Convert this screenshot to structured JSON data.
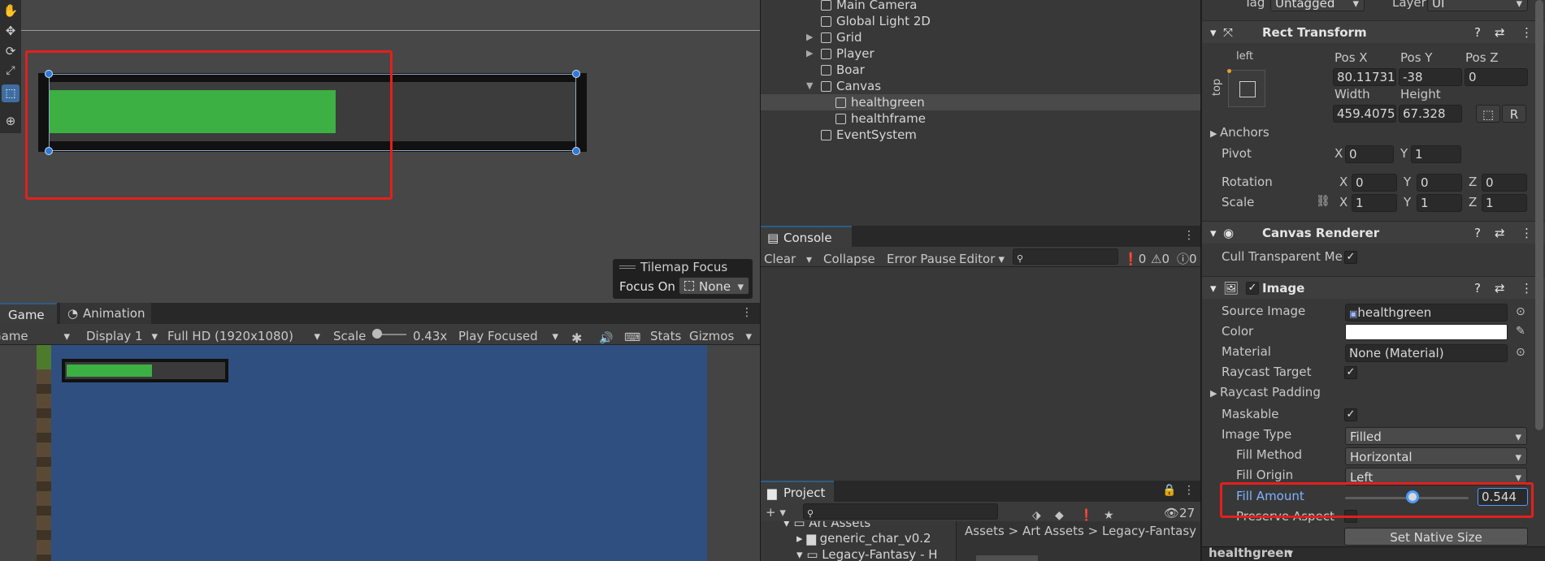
{
  "scene": {
    "tools": [
      "hand-tool",
      "move-tool",
      "rotate-tool",
      "scale-tool",
      "rect-tool",
      "transform-tool"
    ],
    "tilemap_focus": {
      "title": "Tilemap Focus",
      "focus_label": "Focus On",
      "focus_value": "None"
    }
  },
  "game": {
    "tabs": [
      {
        "label": "Game"
      },
      {
        "label": "Animation"
      }
    ],
    "toolbar": {
      "view_select": "Game",
      "display": "Display 1",
      "resolution": "Full HD (1920x1080)",
      "scale_label": "Scale",
      "scale_value": "0.43x",
      "play_mode": "Play Focused",
      "stats": "Stats",
      "gizmos": "Gizmos"
    },
    "health_fill": 0.544
  },
  "hierarchy": {
    "items": [
      {
        "label": "Main Camera",
        "indent": 1,
        "arrow": ""
      },
      {
        "label": "Global Light 2D",
        "indent": 1,
        "arrow": ""
      },
      {
        "label": "Grid",
        "indent": 1,
        "arrow": "▶"
      },
      {
        "label": "Player",
        "indent": 1,
        "arrow": "▶"
      },
      {
        "label": "Boar",
        "indent": 1,
        "arrow": ""
      },
      {
        "label": "Canvas",
        "indent": 1,
        "arrow": "▼"
      },
      {
        "label": "healthgreen",
        "indent": 2,
        "arrow": ""
      },
      {
        "label": "healthframe",
        "indent": 2,
        "arrow": ""
      },
      {
        "label": "EventSystem",
        "indent": 1,
        "arrow": ""
      }
    ]
  },
  "console": {
    "tab": "Console",
    "clear": "Clear",
    "collapse": "Collapse",
    "error_pause": "Error Pause",
    "editor": "Editor",
    "count_errors": "0",
    "count_warnings": "0",
    "count_info": "0"
  },
  "project": {
    "tab": "Project",
    "hidden_count": "27",
    "breadcrumb": [
      "Assets",
      "Art Assets",
      "Legacy-Fantasy"
    ],
    "tree": [
      {
        "label": "Art Assets"
      },
      {
        "label": "generic_char_v0.2"
      },
      {
        "label": "Legacy-Fantasy - H"
      }
    ]
  },
  "inspector": {
    "tag_label": "Tag",
    "tag_value": "Untagged",
    "layer_label": "Layer",
    "layer_value": "UI",
    "rect_transform": {
      "title": "Rect Transform",
      "anchor_h": "left",
      "anchor_v": "top",
      "pos_x_label": "Pos X",
      "pos_x": "80.11731",
      "pos_y_label": "Pos Y",
      "pos_y": "-38",
      "pos_z_label": "Pos Z",
      "pos_z": "0",
      "width_label": "Width",
      "width": "459.4075",
      "height_label": "Height",
      "height": "67.328",
      "anchors": "Anchors",
      "pivot": "Pivot",
      "pivot_x": "0",
      "pivot_y": "1",
      "rotation": "Rotation",
      "rot_x": "0",
      "rot_y": "0",
      "rot_z": "0",
      "scale": "Scale",
      "scale_x": "1",
      "scale_y": "1",
      "scale_z": "1"
    },
    "canvas_renderer": {
      "title": "Canvas Renderer",
      "cull_label": "Cull Transparent Me"
    },
    "image": {
      "title": "Image",
      "source_image_label": "Source Image",
      "source_image": "healthgreen",
      "color_label": "Color",
      "color": "#ffffff",
      "material_label": "Material",
      "material": "None (Material)",
      "raycast_target": "Raycast Target",
      "raycast_padding": "Raycast Padding",
      "maskable": "Maskable",
      "image_type_label": "Image Type",
      "image_type": "Filled",
      "fill_method_label": "Fill Method",
      "fill_method": "Horizontal",
      "fill_origin_label": "Fill Origin",
      "fill_origin": "Left",
      "fill_amount_label": "Fill Amount",
      "fill_amount": "0.544",
      "preserve_aspect": "Preserve Aspect",
      "set_native_size": "Set Native Size"
    },
    "footer_label": "healthgreen"
  },
  "colors": {
    "health_green": "#3cb043",
    "selection_red": "#e3201c",
    "game_bg": "#2f4f80",
    "accent_blue": "#4c9bff"
  }
}
